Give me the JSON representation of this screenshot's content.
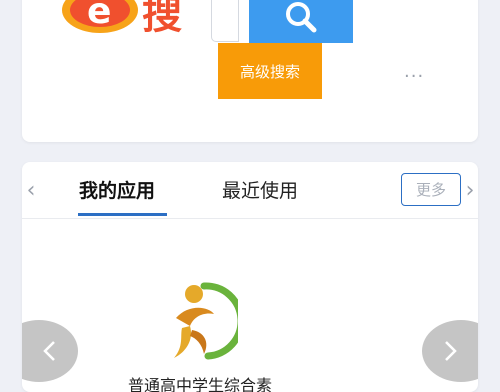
{
  "header": {
    "logo_text": "e搜",
    "search_icon": "search-icon",
    "advanced_search_label": "高级搜索",
    "more_icon": "more-dots-icon",
    "more_text": "···"
  },
  "apps": {
    "prev_arrow": "‹",
    "next_arrow": "›",
    "tabs": [
      {
        "label": "我的应用",
        "active": true
      },
      {
        "label": "最近使用",
        "active": false
      }
    ],
    "more_label": "更多",
    "items": [
      {
        "name": "普通高中学生综合素",
        "icon": "student-quality-icon"
      }
    ],
    "carousel_prev_icon": "chevron-left-icon",
    "carousel_next_icon": "chevron-right-icon"
  },
  "colors": {
    "accent_blue": "#3d9bef",
    "accent_orange": "#f89b08",
    "tab_underline": "#2c6fc4",
    "logo_red": "#f0502e",
    "background": "#eef0f6"
  }
}
